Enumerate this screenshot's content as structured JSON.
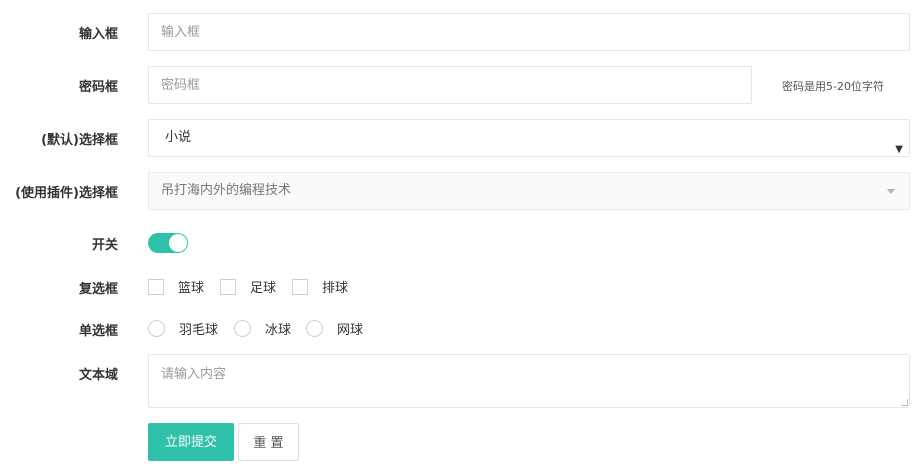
{
  "form": {
    "input": {
      "label": "输入框",
      "placeholder": "输入框",
      "value": ""
    },
    "password": {
      "label": "密码框",
      "placeholder": "密码框",
      "value": "",
      "help": "密码是用5-20位字符"
    },
    "default_select": {
      "label": "(默认)选择框",
      "selected": "小说",
      "caret": "▼"
    },
    "plugin_select": {
      "label": "(使用插件)选择框",
      "selected": "吊打海内外的编程技术"
    },
    "switch": {
      "label": "开关",
      "on": true
    },
    "checkbox": {
      "label": "复选框",
      "options": [
        "篮球",
        "足球",
        "排球"
      ]
    },
    "radio": {
      "label": "单选框",
      "options": [
        "羽毛球",
        "冰球",
        "网球"
      ]
    },
    "textarea": {
      "label": "文本域",
      "placeholder": "请输入内容",
      "value": ""
    },
    "buttons": {
      "submit": "立即提交",
      "reset": "重 置"
    }
  },
  "colors": {
    "accent": "#2fc1aa",
    "border": "#e6e6e6",
    "placeholder": "#999999"
  }
}
